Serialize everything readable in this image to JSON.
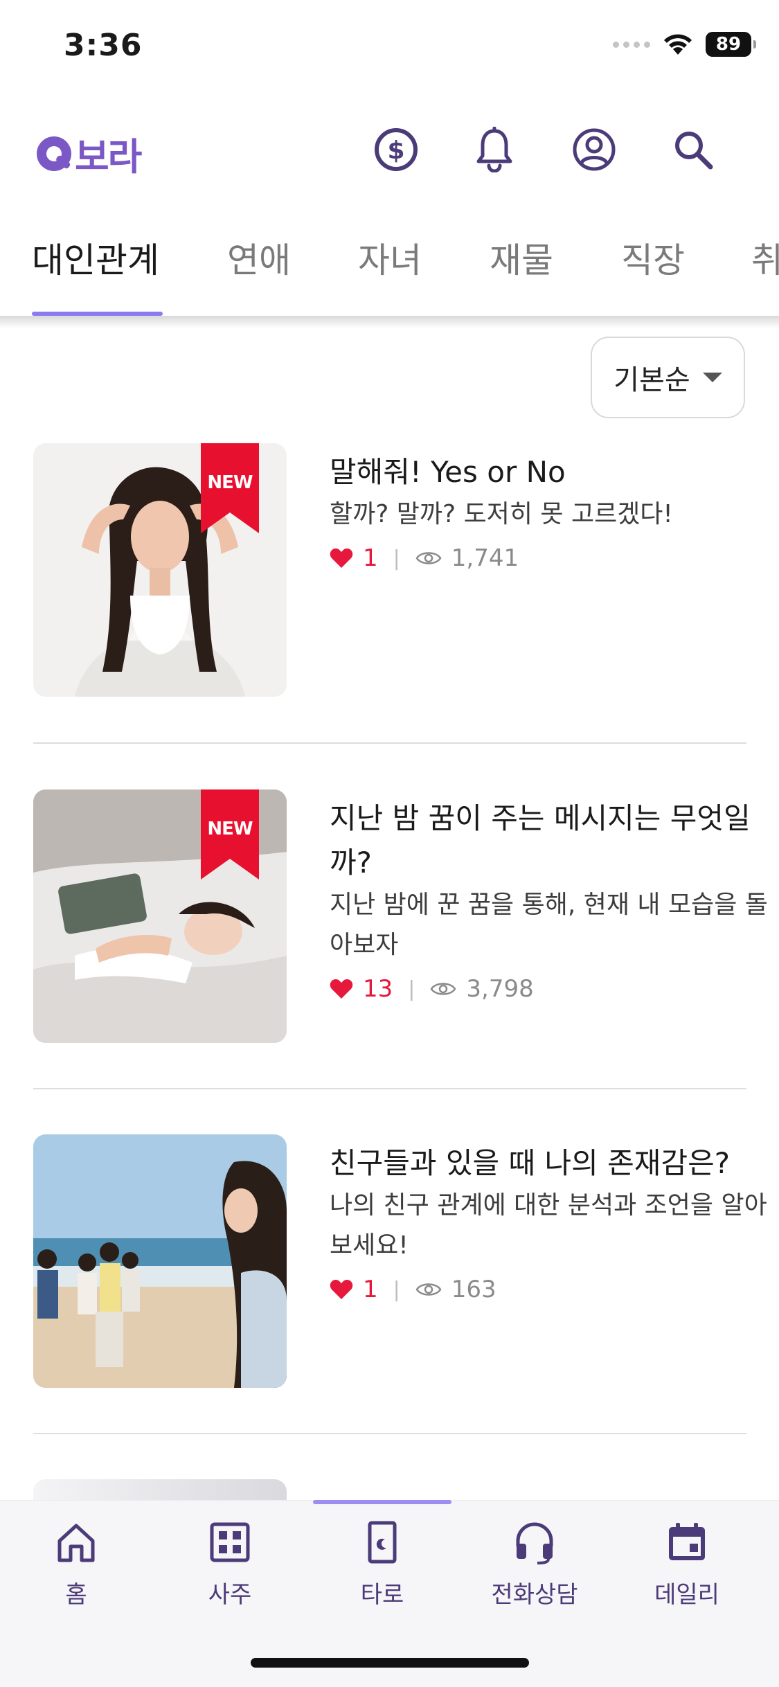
{
  "status_bar": {
    "time": "3:36",
    "battery": "89"
  },
  "header": {
    "logo_text": "보라"
  },
  "tabs": [
    {
      "label": "대인관계",
      "active": true
    },
    {
      "label": "연애",
      "active": false
    },
    {
      "label": "자녀",
      "active": false
    },
    {
      "label": "재물",
      "active": false
    },
    {
      "label": "직장",
      "active": false
    },
    {
      "label": "취",
      "active": false
    }
  ],
  "sort": {
    "label": "기본순"
  },
  "items": [
    {
      "badge": "NEW",
      "title": "말해줘! Yes or No",
      "description": "할까? 말까? 도저히 못 고르겠다!",
      "likes": "1",
      "views": "1,741"
    },
    {
      "badge": "NEW",
      "title": "지난 밤 꿈이 주는 메시지는 무엇일까?",
      "description": "지난 밤에 꾼 꿈을 통해, 현재 내 모습을 돌아보자",
      "likes": "13",
      "views": "3,798"
    },
    {
      "badge": "",
      "title": "친구들과 있을 때 나의 존재감은?",
      "description": "나의 친구 관계에 대한 분석과 조언을 알아보세요!",
      "likes": "1",
      "views": "163"
    }
  ],
  "bottom_nav": [
    {
      "label": "홈",
      "icon": "home-icon"
    },
    {
      "label": "사주",
      "icon": "grid-icon"
    },
    {
      "label": "타로",
      "icon": "tarot-card-icon"
    },
    {
      "label": "전화상담",
      "icon": "headset-icon"
    },
    {
      "label": "데일리",
      "icon": "calendar-icon"
    }
  ],
  "colors": {
    "brand": "#7c58c6",
    "accent_underline": "#8a7cf0",
    "like": "#e6183c",
    "ribbon": "#e8102f",
    "nav_label": "#4b3b78"
  }
}
